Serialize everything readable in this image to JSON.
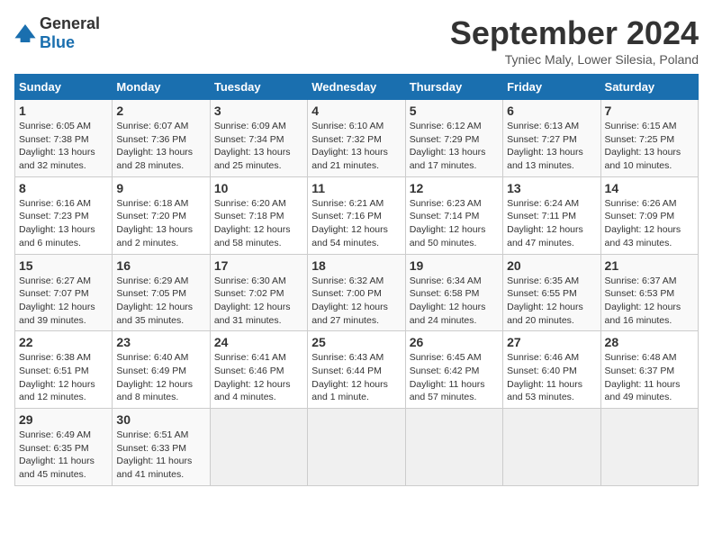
{
  "logo": {
    "text_general": "General",
    "text_blue": "Blue"
  },
  "header": {
    "month_title": "September 2024",
    "location": "Tyniec Maly, Lower Silesia, Poland"
  },
  "calendar": {
    "days_of_week": [
      "Sunday",
      "Monday",
      "Tuesday",
      "Wednesday",
      "Thursday",
      "Friday",
      "Saturday"
    ],
    "weeks": [
      [
        {
          "day": "",
          "info": ""
        },
        {
          "day": "2",
          "info": "Sunrise: 6:07 AM\nSunset: 7:36 PM\nDaylight: 13 hours\nand 28 minutes."
        },
        {
          "day": "3",
          "info": "Sunrise: 6:09 AM\nSunset: 7:34 PM\nDaylight: 13 hours\nand 25 minutes."
        },
        {
          "day": "4",
          "info": "Sunrise: 6:10 AM\nSunset: 7:32 PM\nDaylight: 13 hours\nand 21 minutes."
        },
        {
          "day": "5",
          "info": "Sunrise: 6:12 AM\nSunset: 7:29 PM\nDaylight: 13 hours\nand 17 minutes."
        },
        {
          "day": "6",
          "info": "Sunrise: 6:13 AM\nSunset: 7:27 PM\nDaylight: 13 hours\nand 13 minutes."
        },
        {
          "day": "7",
          "info": "Sunrise: 6:15 AM\nSunset: 7:25 PM\nDaylight: 13 hours\nand 10 minutes."
        }
      ],
      [
        {
          "day": "1",
          "info": "Sunrise: 6:05 AM\nSunset: 7:38 PM\nDaylight: 13 hours\nand 32 minutes."
        },
        {
          "day": "",
          "info": ""
        },
        {
          "day": "",
          "info": ""
        },
        {
          "day": "",
          "info": ""
        },
        {
          "day": "",
          "info": ""
        },
        {
          "day": "",
          "info": ""
        },
        {
          "day": "",
          "info": ""
        }
      ],
      [
        {
          "day": "8",
          "info": "Sunrise: 6:16 AM\nSunset: 7:23 PM\nDaylight: 13 hours\nand 6 minutes."
        },
        {
          "day": "9",
          "info": "Sunrise: 6:18 AM\nSunset: 7:20 PM\nDaylight: 13 hours\nand 2 minutes."
        },
        {
          "day": "10",
          "info": "Sunrise: 6:20 AM\nSunset: 7:18 PM\nDaylight: 12 hours\nand 58 minutes."
        },
        {
          "day": "11",
          "info": "Sunrise: 6:21 AM\nSunset: 7:16 PM\nDaylight: 12 hours\nand 54 minutes."
        },
        {
          "day": "12",
          "info": "Sunrise: 6:23 AM\nSunset: 7:14 PM\nDaylight: 12 hours\nand 50 minutes."
        },
        {
          "day": "13",
          "info": "Sunrise: 6:24 AM\nSunset: 7:11 PM\nDaylight: 12 hours\nand 47 minutes."
        },
        {
          "day": "14",
          "info": "Sunrise: 6:26 AM\nSunset: 7:09 PM\nDaylight: 12 hours\nand 43 minutes."
        }
      ],
      [
        {
          "day": "15",
          "info": "Sunrise: 6:27 AM\nSunset: 7:07 PM\nDaylight: 12 hours\nand 39 minutes."
        },
        {
          "day": "16",
          "info": "Sunrise: 6:29 AM\nSunset: 7:05 PM\nDaylight: 12 hours\nand 35 minutes."
        },
        {
          "day": "17",
          "info": "Sunrise: 6:30 AM\nSunset: 7:02 PM\nDaylight: 12 hours\nand 31 minutes."
        },
        {
          "day": "18",
          "info": "Sunrise: 6:32 AM\nSunset: 7:00 PM\nDaylight: 12 hours\nand 27 minutes."
        },
        {
          "day": "19",
          "info": "Sunrise: 6:34 AM\nSunset: 6:58 PM\nDaylight: 12 hours\nand 24 minutes."
        },
        {
          "day": "20",
          "info": "Sunrise: 6:35 AM\nSunset: 6:55 PM\nDaylight: 12 hours\nand 20 minutes."
        },
        {
          "day": "21",
          "info": "Sunrise: 6:37 AM\nSunset: 6:53 PM\nDaylight: 12 hours\nand 16 minutes."
        }
      ],
      [
        {
          "day": "22",
          "info": "Sunrise: 6:38 AM\nSunset: 6:51 PM\nDaylight: 12 hours\nand 12 minutes."
        },
        {
          "day": "23",
          "info": "Sunrise: 6:40 AM\nSunset: 6:49 PM\nDaylight: 12 hours\nand 8 minutes."
        },
        {
          "day": "24",
          "info": "Sunrise: 6:41 AM\nSunset: 6:46 PM\nDaylight: 12 hours\nand 4 minutes."
        },
        {
          "day": "25",
          "info": "Sunrise: 6:43 AM\nSunset: 6:44 PM\nDaylight: 12 hours\nand 1 minute."
        },
        {
          "day": "26",
          "info": "Sunrise: 6:45 AM\nSunset: 6:42 PM\nDaylight: 11 hours\nand 57 minutes."
        },
        {
          "day": "27",
          "info": "Sunrise: 6:46 AM\nSunset: 6:40 PM\nDaylight: 11 hours\nand 53 minutes."
        },
        {
          "day": "28",
          "info": "Sunrise: 6:48 AM\nSunset: 6:37 PM\nDaylight: 11 hours\nand 49 minutes."
        }
      ],
      [
        {
          "day": "29",
          "info": "Sunrise: 6:49 AM\nSunset: 6:35 PM\nDaylight: 11 hours\nand 45 minutes."
        },
        {
          "day": "30",
          "info": "Sunrise: 6:51 AM\nSunset: 6:33 PM\nDaylight: 11 hours\nand 41 minutes."
        },
        {
          "day": "",
          "info": ""
        },
        {
          "day": "",
          "info": ""
        },
        {
          "day": "",
          "info": ""
        },
        {
          "day": "",
          "info": ""
        },
        {
          "day": "",
          "info": ""
        }
      ]
    ]
  }
}
